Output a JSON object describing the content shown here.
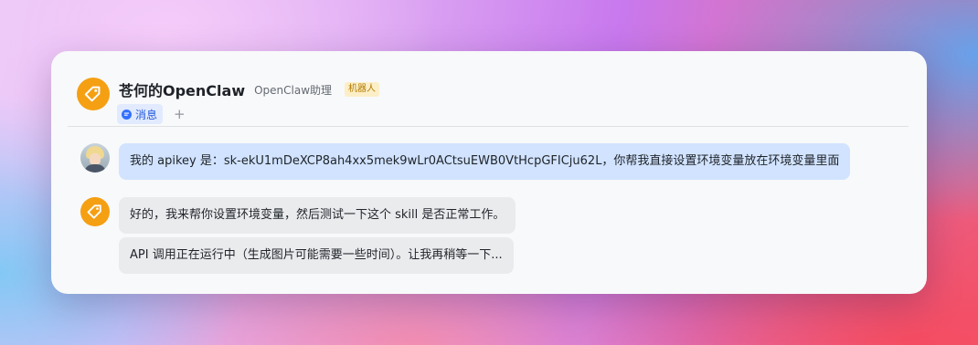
{
  "header": {
    "title": "苍何的OpenClaw",
    "subtitle": "OpenClaw助理",
    "badge": "机器人",
    "avatar_icon": "tag-icon",
    "tabs": [
      {
        "label": "消息",
        "icon": "chat-icon",
        "active": true
      }
    ],
    "add_tab_label": "+"
  },
  "messages": [
    {
      "sender": "user",
      "text": "我的 apikey 是：sk-ekU1mDeXCP8ah4xx5mek9wLr0ACtsuEWB0VtHcpGFICju62L，你帮我直接设置环境变量放在环境变量里面"
    },
    {
      "sender": "bot",
      "parts": [
        "好的，我来帮你设置环境变量，然后测试一下这个 skill 是否正常工作。",
        "API 调用正在运行中（生成图片可能需要一些时间）。让我再稍等一下..."
      ]
    }
  ],
  "colors": {
    "bot_avatar": "#f59f13",
    "user_bubble": "#d1e3ff",
    "bot_bubble": "#eaebed",
    "tab_active_bg": "#e1eaff",
    "tab_active_text": "#245bdb",
    "badge_bg": "#fcefc8",
    "badge_text": "#b27a00"
  }
}
